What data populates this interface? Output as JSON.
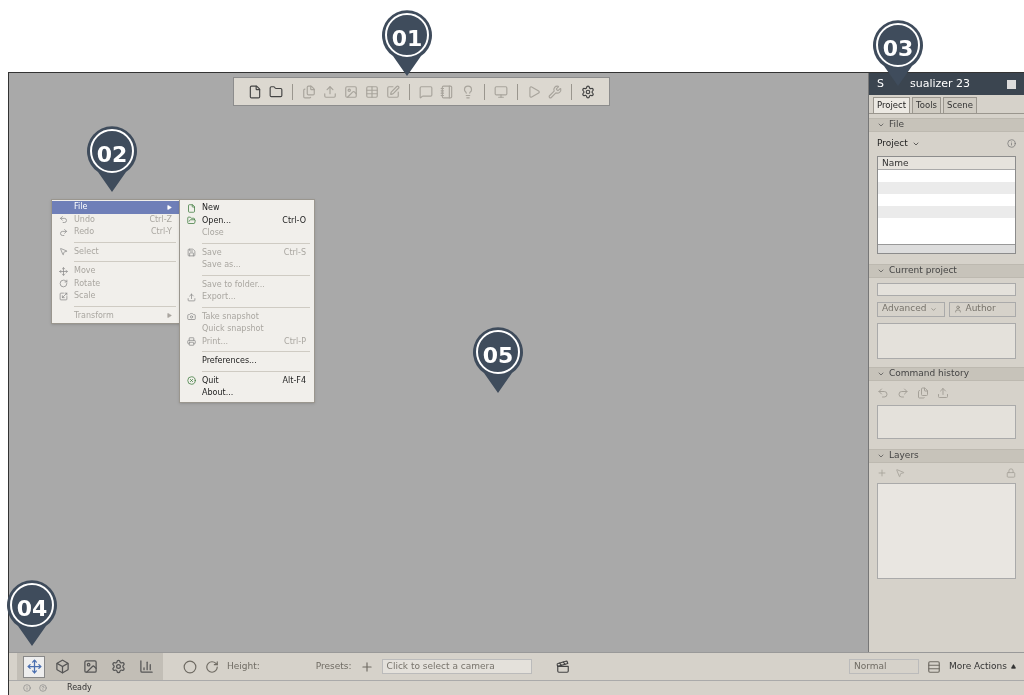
{
  "markers": [
    {
      "label": "01"
    },
    {
      "label": "02"
    },
    {
      "label": "03"
    },
    {
      "label": "04"
    },
    {
      "label": "05"
    }
  ],
  "top_toolbar": {
    "groups": [
      [
        {
          "disabled": false
        },
        {
          "disabled": false
        }
      ],
      [
        {
          "disabled": true
        },
        {
          "disabled": true
        },
        {
          "disabled": true
        },
        {
          "disabled": true
        },
        {
          "disabled": true
        }
      ],
      [
        {
          "disabled": true
        },
        {
          "disabled": true
        },
        {
          "disabled": true
        }
      ],
      [
        {
          "disabled": true
        }
      ],
      [
        {
          "disabled": true
        },
        {
          "disabled": true
        }
      ],
      [
        {
          "disabled": false
        }
      ]
    ]
  },
  "context_menu": {
    "items": [
      {
        "kind": "submenu",
        "label": "File",
        "disabled": false,
        "selected": true
      },
      {
        "kind": "item",
        "label": "Undo",
        "shortcut": "Ctrl-Z",
        "disabled": true,
        "selected": false
      },
      {
        "kind": "item",
        "label": "Redo",
        "shortcut": "Ctrl-Y",
        "disabled": true,
        "selected": false
      },
      {
        "kind": "separator"
      },
      {
        "kind": "item",
        "label": "Select",
        "disabled": true,
        "selected": false
      },
      {
        "kind": "separator"
      },
      {
        "kind": "item",
        "label": "Move",
        "disabled": true,
        "selected": false
      },
      {
        "kind": "item",
        "label": "Rotate",
        "disabled": true,
        "selected": false
      },
      {
        "kind": "item",
        "label": "Scale",
        "disabled": true,
        "selected": false
      },
      {
        "kind": "separator"
      },
      {
        "kind": "submenu",
        "label": "Transform",
        "disabled": true,
        "selected": false
      }
    ],
    "submenu": [
      {
        "kind": "item",
        "label": "New",
        "disabled": false
      },
      {
        "kind": "item",
        "label": "Open...",
        "shortcut": "Ctrl-O",
        "disabled": false
      },
      {
        "kind": "item",
        "label": "Close",
        "disabled": true
      },
      {
        "kind": "separator"
      },
      {
        "kind": "item",
        "label": "Save",
        "shortcut": "Ctrl-S",
        "disabled": true
      },
      {
        "kind": "item",
        "label": "Save as...",
        "disabled": true
      },
      {
        "kind": "separator"
      },
      {
        "kind": "item",
        "label": "Save to folder...",
        "disabled": true
      },
      {
        "kind": "item",
        "label": "Export...",
        "disabled": true
      },
      {
        "kind": "separator"
      },
      {
        "kind": "item",
        "label": "Take snapshot",
        "disabled": true
      },
      {
        "kind": "item",
        "label": "Quick snapshot",
        "disabled": true
      },
      {
        "kind": "item",
        "label": "Print...",
        "shortcut": "Ctrl-P",
        "disabled": true
      },
      {
        "kind": "separator"
      },
      {
        "kind": "item",
        "label": "Preferences...",
        "disabled": false
      },
      {
        "kind": "separator"
      },
      {
        "kind": "item",
        "label": "Quit",
        "shortcut": "Alt-F4",
        "disabled": false
      },
      {
        "kind": "item",
        "label": "About...",
        "disabled": false
      }
    ]
  },
  "side_panel": {
    "title_parts": [
      "S",
      "sualizer 23"
    ],
    "tabs": [
      {
        "label": "Project",
        "selected": true
      },
      {
        "label": "Tools",
        "selected": false
      },
      {
        "label": "Scene",
        "selected": false
      }
    ],
    "file_section": {
      "title": "File",
      "dropdown": "Project",
      "table": {
        "columns": [
          "Name"
        ]
      }
    },
    "current_project": {
      "title": "Current project",
      "advanced": "Advanced",
      "author": "Author"
    },
    "command_history": {
      "title": "Command history"
    },
    "layers": {
      "title": "Layers"
    }
  },
  "bottom_toolbar": {
    "modes": [
      {
        "selected": true
      },
      {
        "selected": false
      },
      {
        "selected": false
      },
      {
        "selected": false
      },
      {
        "selected": false
      }
    ],
    "height_label": "Height:",
    "presets_label": "Presets:",
    "camera_placeholder": "Click to select a camera",
    "blend_mode": "Normal",
    "more_actions": "More Actions"
  },
  "status_bar": {
    "text": "Ready"
  }
}
